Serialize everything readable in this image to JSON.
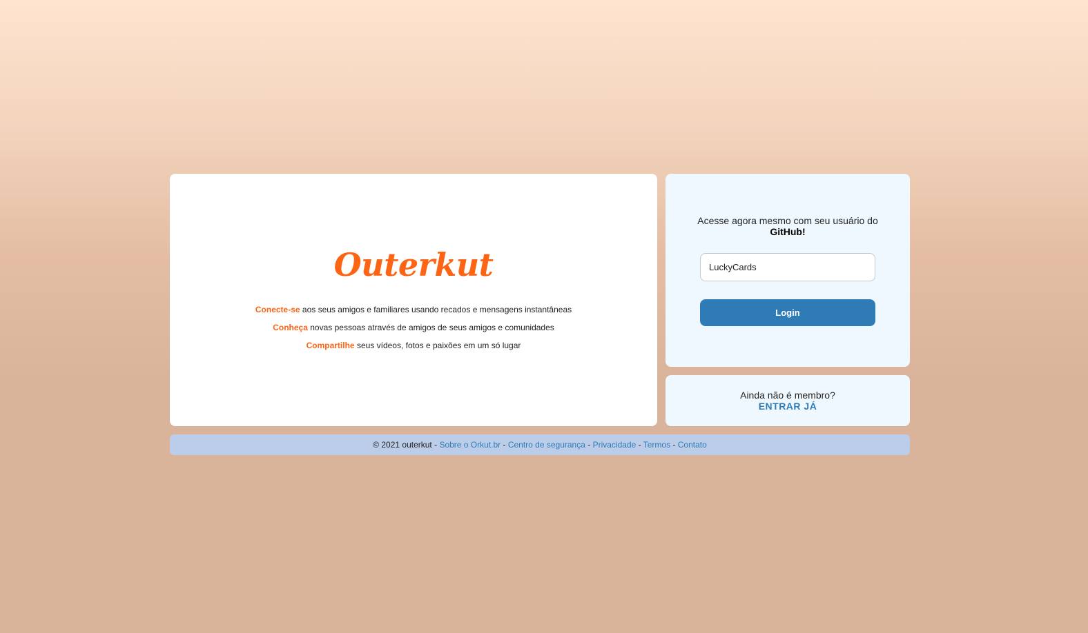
{
  "brand": {
    "logo": "Outerkut",
    "accent_color": "#fd6413"
  },
  "intro": {
    "lines": [
      {
        "highlight": "Conecte-se",
        "text": " aos seus amigos e familiares usando recados e mensagens instantâneas"
      },
      {
        "highlight": "Conheça",
        "text": " novas pessoas através de amigos de seus amigos e comunidades"
      },
      {
        "highlight": "Compartilhe",
        "text": " seus vídeos, fotos e paixões em um só lugar"
      }
    ]
  },
  "login": {
    "prompt_prefix": "Acesse agora mesmo com seu usuário do ",
    "prompt_bold": "GitHub",
    "prompt_suffix": "!",
    "username_value": "LuckyCards",
    "button_label": "Login",
    "button_color": "#2e7bb5"
  },
  "signup": {
    "question": "Ainda não é membro?",
    "link_label": "ENTRAR JÁ"
  },
  "footer": {
    "copyright": "© 2021 outerkut - ",
    "sep": " - ",
    "links": [
      "Sobre o Orkut.br",
      "Centro de segurança",
      "Privacidade",
      "Termos",
      "Contato"
    ]
  }
}
